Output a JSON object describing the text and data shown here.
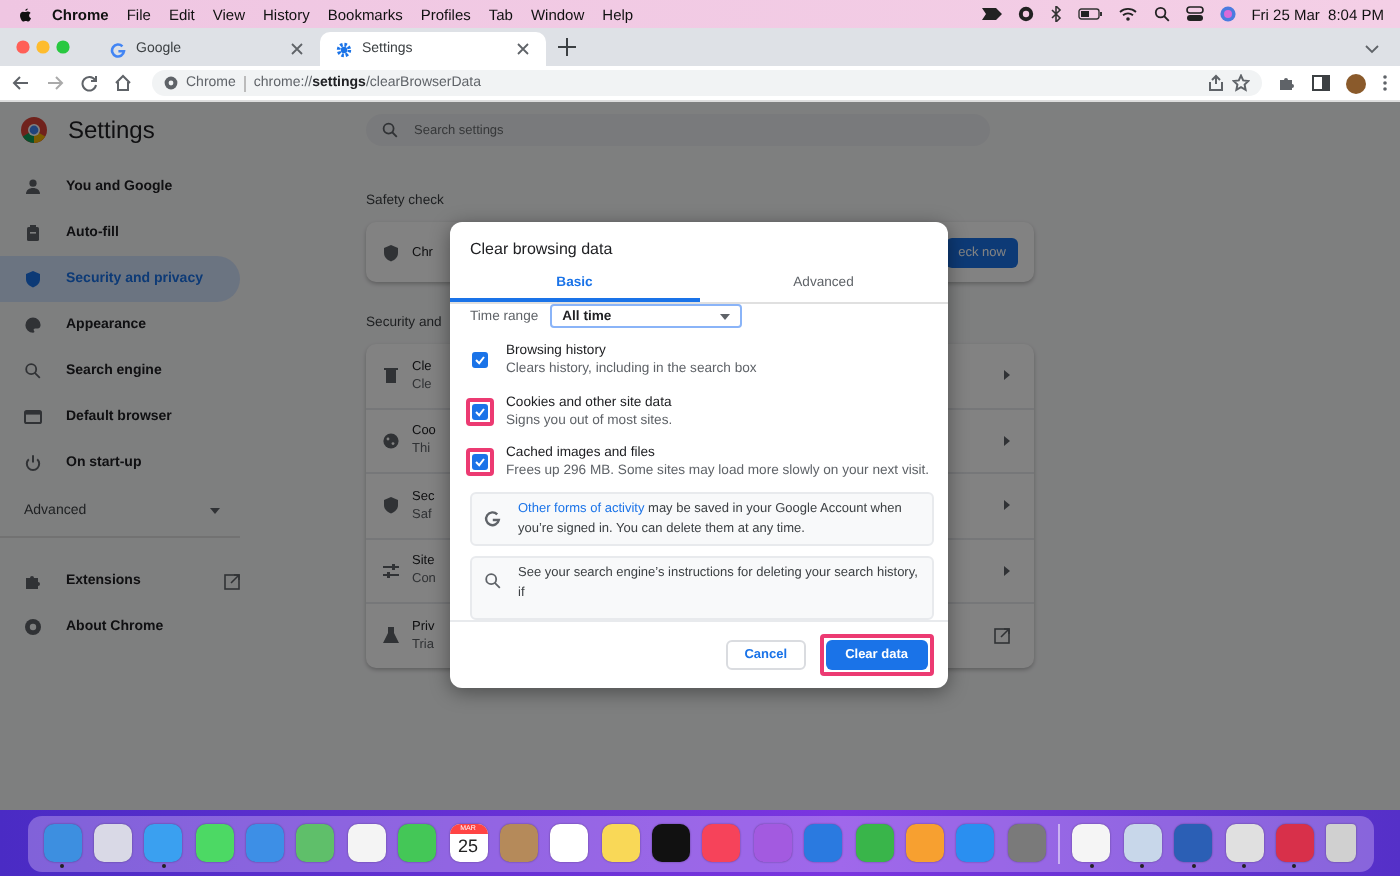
{
  "menu_bar": {
    "items": [
      {
        "label": "Chrome",
        "kind": "app"
      },
      {
        "label": "File",
        "kind": "menu"
      },
      {
        "label": "Edit",
        "kind": "menu"
      },
      {
        "label": "View",
        "kind": "menu"
      },
      {
        "label": "History",
        "kind": "menu"
      },
      {
        "label": "Bookmarks",
        "kind": "menu"
      },
      {
        "label": "Profiles",
        "kind": "menu"
      },
      {
        "label": "Tab",
        "kind": "menu"
      },
      {
        "label": "Window",
        "kind": "menu"
      },
      {
        "label": "Help",
        "kind": "menu"
      }
    ],
    "clock": "Fri 25 Mar  8:04 PM"
  },
  "tabs": [
    {
      "title": "Google",
      "selected": false
    },
    {
      "title": "Settings",
      "selected": true
    }
  ],
  "address_bar": {
    "site_label": "Chrome",
    "url": "chrome://**settings**/clearBrowserData"
  },
  "settings": {
    "title": "Settings",
    "search": {
      "placeholder": "Search settings"
    },
    "sidebar": {
      "items": [
        {
          "label": "You and Google",
          "selected": false
        },
        {
          "label": "Auto-fill",
          "selected": false
        },
        {
          "label": "Security and privacy",
          "selected": true
        },
        {
          "label": "Appearance",
          "selected": false
        },
        {
          "label": "Search engine",
          "selected": false
        },
        {
          "label": "Default browser",
          "selected": false
        },
        {
          "label": "On start-up",
          "selected": false
        }
      ],
      "advanced": "Advanced",
      "extra_items": [
        {
          "label": "Extensions",
          "kind": "external"
        },
        {
          "label": "About Chrome",
          "kind": "plain"
        }
      ]
    },
    "safety_check": {
      "heading": "Safety check",
      "card_text": "Chr",
      "button": "eck now"
    },
    "privacy": {
      "heading": "Security and",
      "rows": [
        {
          "title": "Cle",
          "subtitle": "Cle",
          "kind": "arrow"
        },
        {
          "title": "Coo",
          "subtitle": "Thi",
          "kind": "arrow"
        },
        {
          "title": "Sec",
          "subtitle": "Saf",
          "kind": "arrow"
        },
        {
          "title": "Site",
          "subtitle": "Con",
          "kind": "arrow"
        },
        {
          "title": "Priv",
          "subtitle": "Tria",
          "kind": "external"
        }
      ]
    }
  },
  "dialog": {
    "title": "Clear browsing data",
    "tabs": [
      {
        "label": "Basic",
        "selected": true
      },
      {
        "label": "Advanced",
        "selected": false
      }
    ],
    "time_range": {
      "label": "Time range",
      "value": "All time"
    },
    "options": [
      {
        "title": "Browsing history",
        "description": "Clears history, including in the search box",
        "checked": true,
        "highlighted": false
      },
      {
        "title": "Cookies and other site data",
        "description": "Signs you out of most sites.",
        "checked": true,
        "highlighted": true
      },
      {
        "title": "Cached images and files",
        "description": "Frees up 296 MB. Some sites may load more slowly on your next visit.",
        "checked": true,
        "highlighted": true
      }
    ],
    "google_note": {
      "link": "Other forms of activity",
      "text": " may be saved in your Google Account when you’re signed in. You can delete them at any time."
    },
    "search_note": "See your search engine’s instructions for deleting your search history, if",
    "buttons": [
      {
        "label": "Cancel",
        "kind": "secondary",
        "highlighted": false
      },
      {
        "label": "Clear data",
        "kind": "primary",
        "highlighted": true
      }
    ]
  },
  "dock": {
    "apps": [
      {
        "kind": "app",
        "color": "#3d8fe0",
        "running": true
      },
      {
        "kind": "app",
        "color": "#d9d9e6",
        "running": false
      },
      {
        "kind": "app",
        "color": "#3aa0f0",
        "running": true
      },
      {
        "kind": "app",
        "color": "#4cd964",
        "running": false
      },
      {
        "kind": "app",
        "color": "#3d8fe6",
        "running": false
      },
      {
        "kind": "app",
        "color": "#5fbf6a",
        "running": false
      },
      {
        "kind": "app",
        "color": "#f4f4f4",
        "running": false
      },
      {
        "kind": "app",
        "color": "#44c757",
        "running": false
      },
      {
        "kind": "calendar",
        "color": "#ffffff",
        "running": false,
        "month": "MAR",
        "day": "25"
      },
      {
        "kind": "app",
        "color": "#b58a5a",
        "running": false
      },
      {
        "kind": "app",
        "color": "#ffffff",
        "running": false
      },
      {
        "kind": "app",
        "color": "#f9d857",
        "running": false
      },
      {
        "kind": "app",
        "color": "#111111",
        "running": false
      },
      {
        "kind": "app",
        "color": "#f6435a",
        "running": false
      },
      {
        "kind": "app",
        "color": "#a35ae0",
        "running": false
      },
      {
        "kind": "app",
        "color": "#2a7ae0",
        "running": false
      },
      {
        "kind": "app",
        "color": "#39b54a",
        "running": false
      },
      {
        "kind": "app",
        "color": "#f7a030",
        "running": false
      },
      {
        "kind": "app",
        "color": "#2a8ff0",
        "running": false
      },
      {
        "kind": "app",
        "color": "#7a7a7a",
        "running": false
      }
    ],
    "recent": [
      {
        "kind": "app",
        "color": "#f5f5f5",
        "running": true
      },
      {
        "kind": "app",
        "color": "#c8d7ea",
        "running": true
      },
      {
        "kind": "app",
        "color": "#2b5fb5",
        "running": true
      },
      {
        "kind": "app",
        "color": "#e0e0e0",
        "running": true
      },
      {
        "kind": "app",
        "color": "#d8304a",
        "running": true
      },
      {
        "kind": "trash",
        "color": "#d0d0d0",
        "running": false
      }
    ]
  }
}
